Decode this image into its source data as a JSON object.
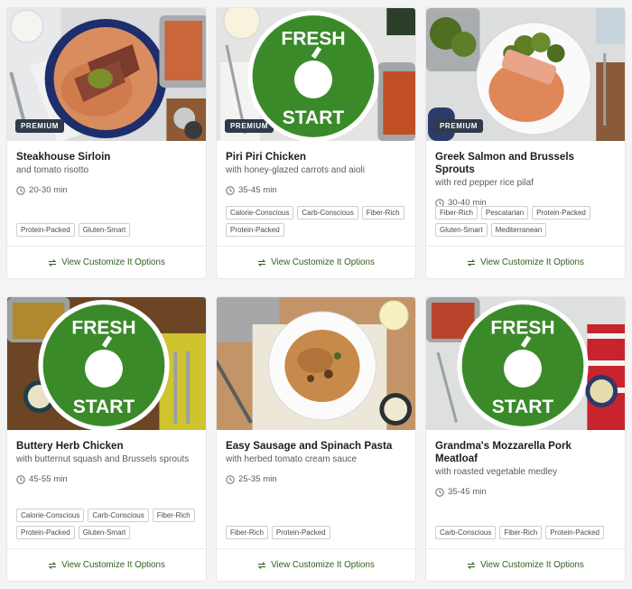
{
  "footer_label": "View Customize It Options",
  "premium_label": "PREMIUM",
  "fresh_start_label": "FRESH START",
  "colors": {
    "accent_green": "#2d5f1f",
    "badge_navy": "#2f3a4a",
    "fresh_start_green": "#3b8a2a"
  },
  "cards": [
    {
      "title": "Steakhouse Sirloin",
      "subtitle": "and tomato risotto",
      "time": "20-30 min",
      "badge": "premium",
      "tags": [
        "Protein-Packed",
        "Gluten-Smart"
      ]
    },
    {
      "title": "Piri Piri Chicken",
      "subtitle": "with honey-glazed carrots and aioli",
      "time": "35-45 min",
      "badge": "premium",
      "fresh_start": true,
      "tags": [
        "Calorie-Conscious",
        "Carb-Conscious",
        "Fiber-Rich",
        "Protein-Packed"
      ]
    },
    {
      "title": "Greek Salmon and Brussels Sprouts",
      "subtitle": "with red pepper rice pilaf",
      "time": "30-40 min",
      "badge": "premium",
      "tags": [
        "Fiber-Rich",
        "Pescatarian",
        "Protein-Packed",
        "Gluten-Smart",
        "Mediterranean"
      ]
    },
    {
      "title": "Buttery Herb Chicken",
      "subtitle": "with butternut squash and Brussels sprouts",
      "time": "45-55 min",
      "fresh_start": true,
      "tags": [
        "Calorie-Conscious",
        "Carb-Conscious",
        "Fiber-Rich",
        "Protein-Packed",
        "Gluten-Smart"
      ]
    },
    {
      "title": "Easy Sausage and Spinach Pasta",
      "subtitle": "with herbed tomato cream sauce",
      "time": "25-35 min",
      "tags": [
        "Fiber-Rich",
        "Protein-Packed"
      ]
    },
    {
      "title": "Grandma's Mozzarella Pork Meatloaf",
      "subtitle": "with roasted vegetable medley",
      "time": "35-45 min",
      "fresh_start": true,
      "tags": [
        "Carb-Conscious",
        "Fiber-Rich",
        "Protein-Packed"
      ]
    }
  ]
}
